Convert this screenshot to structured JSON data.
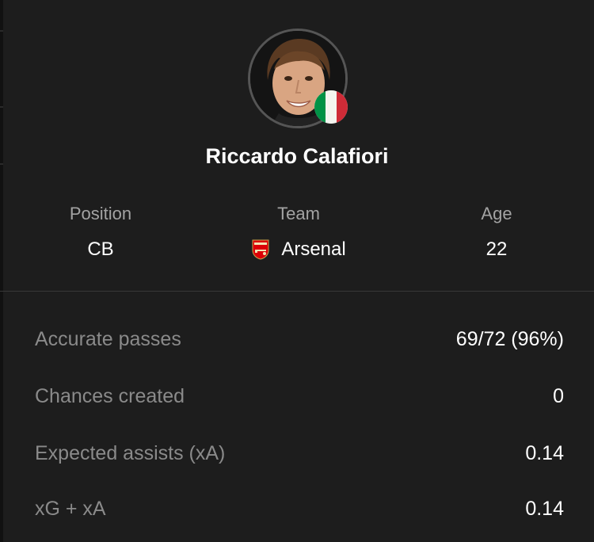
{
  "player": {
    "name": "Riccardo Calafiori",
    "flag": "italy-flag-icon"
  },
  "info": {
    "position_label": "Position",
    "position_value": "CB",
    "team_label": "Team",
    "team_value": "Arsenal",
    "team_crest": "arsenal-crest-icon",
    "age_label": "Age",
    "age_value": "22"
  },
  "stats": [
    {
      "label": "Accurate passes",
      "value": "69/72 (96%)"
    },
    {
      "label": "Chances created",
      "value": "0"
    },
    {
      "label": "Expected assists (xA)",
      "value": "0.14"
    },
    {
      "label": "xG + xA",
      "value": "0.14"
    }
  ],
  "colors": {
    "background": "#1d1d1d",
    "label_gray": "#a3a3a3",
    "stat_label_gray": "#8a8a8a",
    "arsenal_red": "#db0007",
    "italy_green": "#009246",
    "italy_red": "#ce2b37"
  }
}
